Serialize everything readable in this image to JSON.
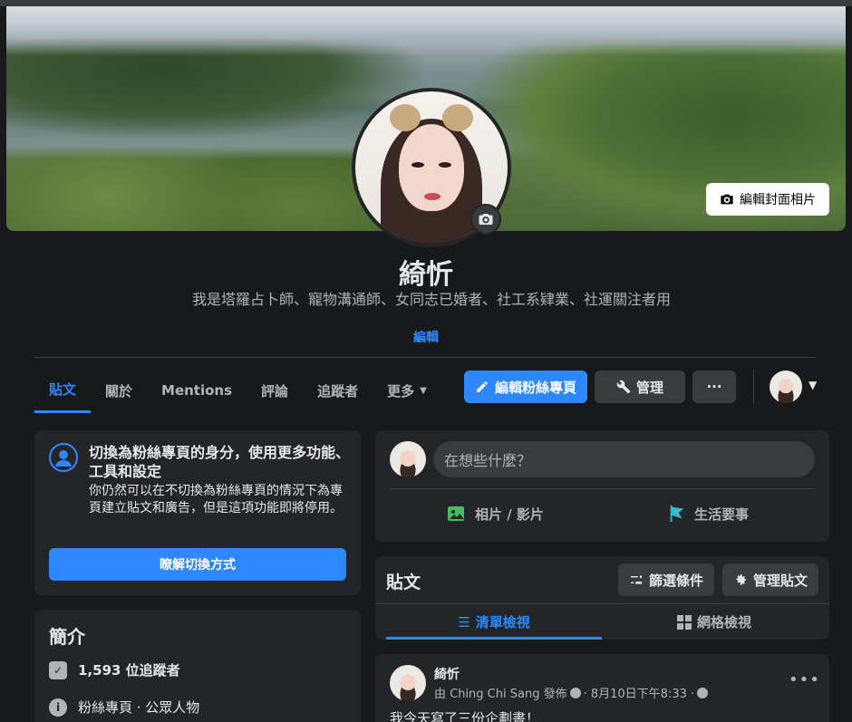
{
  "cover": {
    "edit_button_label": "編輯封面相片"
  },
  "profile": {
    "name": "綺忻",
    "bio": "我是塔羅占卜師、寵物溝通師、女同志已婚者、社工系肄業、社運關注者用",
    "bio_edit": "編輯"
  },
  "tabs": [
    {
      "label": "貼文",
      "active": true
    },
    {
      "label": "關於"
    },
    {
      "label": "Mentions"
    },
    {
      "label": "評論"
    },
    {
      "label": "追蹤者"
    },
    {
      "label": "更多"
    }
  ],
  "actions": {
    "edit_page": "編輯粉絲專頁",
    "manage": "管理",
    "more": "···"
  },
  "switch_card": {
    "title": "切換為粉絲專頁的身分，使用更多功能、工具和設定",
    "description": "你仍然可以在不切換為粉絲專頁的情況下為專頁建立貼文和廣告，但是這項功能即將停用。",
    "button": "瞭解切換方式"
  },
  "intro": {
    "title": "簡介",
    "followers": "1,593 位追蹤者",
    "category": "粉絲專頁 · 公眾人物"
  },
  "composer": {
    "placeholder": "在想些什麼？",
    "photo_video": "相片 / 影片",
    "life_event": "生活要事"
  },
  "posts": {
    "title": "貼文",
    "filter": "篩選條件",
    "manage": "管理貼文",
    "list_view": "清單檢視",
    "grid_view": "網格檢視"
  },
  "post": {
    "author": "綺忻",
    "meta": "由 Ching Chi Sang 發佈",
    "time": "· 8月10日下午8:33 ·",
    "text": "我今天寫了三份企劃書！"
  },
  "colors": {
    "accent": "#2d88ff",
    "bg": "#18191a",
    "card": "#242526"
  }
}
